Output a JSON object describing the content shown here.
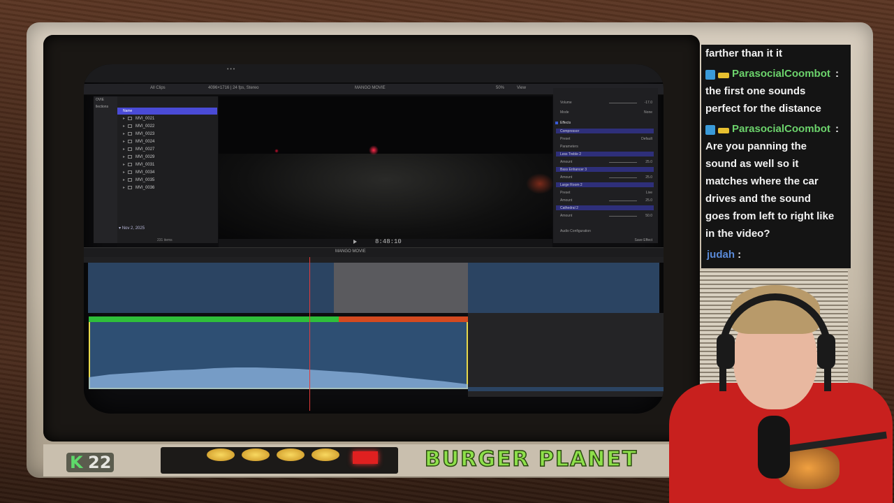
{
  "editor": {
    "project_title": "MANGO MOVIE",
    "toolbar_allclips": "All Clips",
    "format_info": "4096×1716 | 24 fps, Stereo",
    "zoom": "50%",
    "view_label": "View",
    "timecode": "8:48:10",
    "libraries": [
      "OVIE",
      "llections"
    ],
    "list_header": "Name",
    "clips": [
      "MVI_0021",
      "MVI_0022",
      "MVI_0023",
      "MVI_0024",
      "MVI_0027",
      "MVI_0029",
      "MVI_0031",
      "MVI_0034",
      "MVI_0035",
      "MVI_0036"
    ],
    "date_group": "Nov 2, 2025",
    "items_count": "231 items",
    "timeline_title": "MANGO MOVIE",
    "inspector": {
      "volume_label": "Volume",
      "volume_value": "-17.0",
      "mode_label": "Mode",
      "mode_value": "None",
      "effects_label": "Effects",
      "compressor_label": "Compressor",
      "preset_label": "Preset",
      "preset_value": "Default",
      "parameters_label": "Parameters",
      "less_treble": "Less Treble 2",
      "amount_label": "Amount",
      "amount_1": "25.0",
      "bass_enhancer": "Bass Enhancer 3",
      "amount_2": "25.0",
      "large_room": "Large Room 2",
      "preset_live": "Live",
      "amount_3": "25.0",
      "cathedral": "Cathedral 2",
      "amount_4": "50.0",
      "audio_config": "Audio Configuration",
      "save_effects": "Save Effect"
    }
  },
  "overlay": {
    "k_letter": "K",
    "k_count": "22",
    "brand": "BURGER PLANET"
  },
  "chat": {
    "messages": [
      {
        "text": "farther than it it"
      },
      {
        "user": "ParasocialCoombot",
        "lines": [
          "the first one sounds",
          "perfect for the distance"
        ]
      },
      {
        "user": "ParasocialCoombot",
        "lines": [
          "Are you panning the",
          "sound as well so it",
          "matches where the car",
          "drives and the sound",
          "goes from left to right like",
          "in the video?"
        ]
      },
      {
        "user": "judah"
      }
    ]
  },
  "colors": {
    "chat_user": "#6cd36c",
    "brand_green": "#8ee04a",
    "clip_green": "#2fbf3a",
    "clip_red": "#d44a20",
    "playhead": "#e43a3a"
  }
}
